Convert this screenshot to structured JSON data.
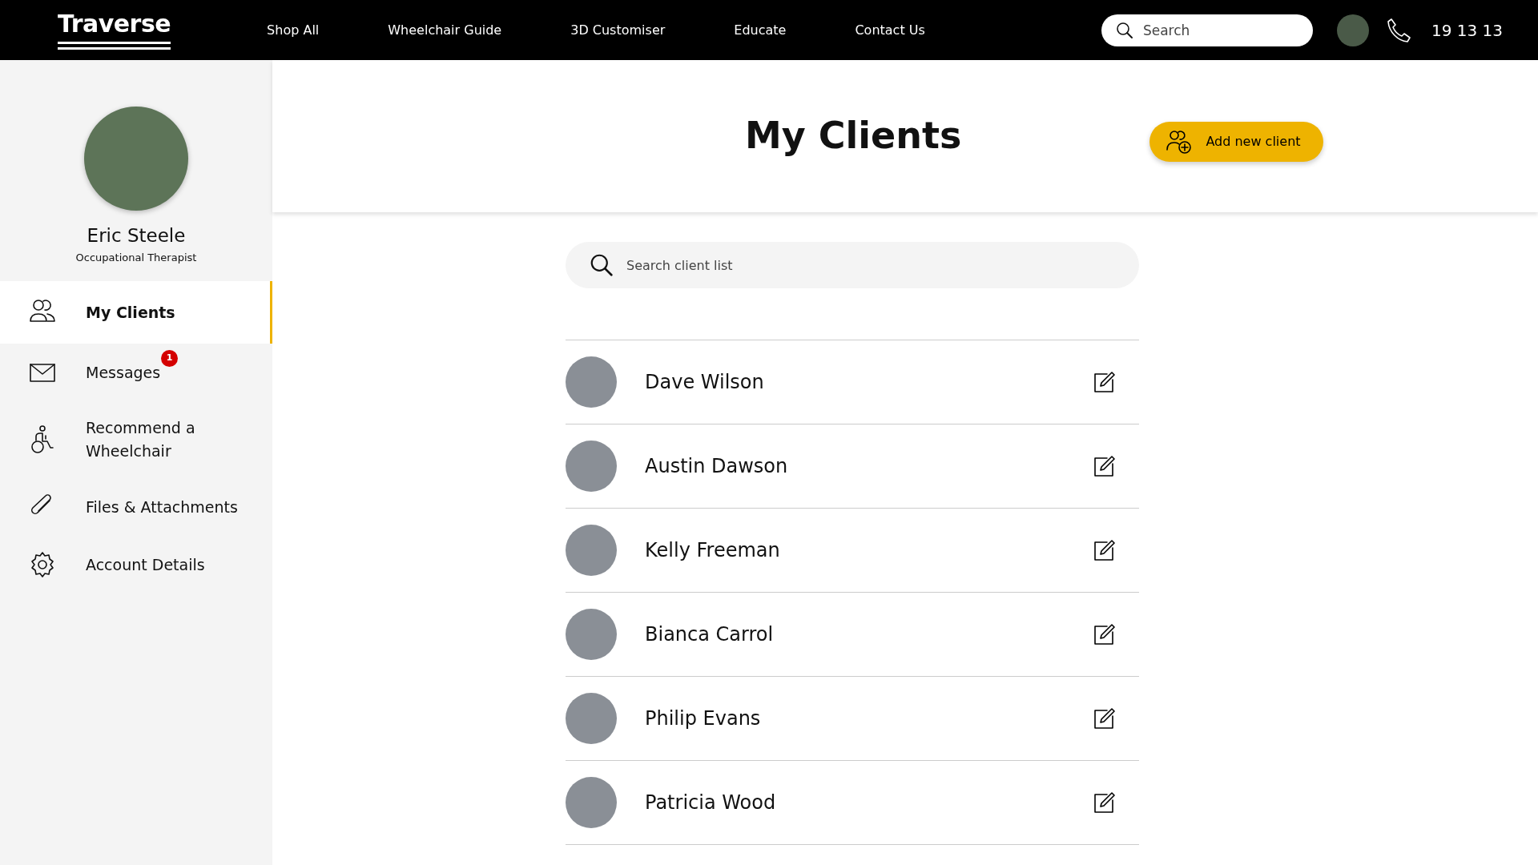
{
  "navbar": {
    "logo": "Traverse",
    "links": [
      {
        "label": "Shop All"
      },
      {
        "label": "Wheelchair Guide"
      },
      {
        "label": "3D Customiser"
      },
      {
        "label": "Educate"
      },
      {
        "label": "Contact Us"
      }
    ],
    "search": {
      "placeholder": "Search"
    },
    "phone": "19 13 13"
  },
  "sidebar": {
    "profile": {
      "name": "Eric Steele",
      "role": "Occupational Therapist"
    },
    "items": [
      {
        "kind": "clients",
        "label": "My Clients",
        "selected": true
      },
      {
        "kind": "messages",
        "label": "Messages",
        "selected": false,
        "badge": "1"
      },
      {
        "kind": "wheelchair",
        "label": "Recommend a Wheelchair",
        "selected": false
      },
      {
        "kind": "files",
        "label": "Files & Attachments",
        "selected": false
      },
      {
        "kind": "account",
        "label": "Account Details",
        "selected": false
      }
    ]
  },
  "main": {
    "title": "My Clients",
    "add_button": "Add new client",
    "search": {
      "placeholder": "Search client list"
    },
    "clients": [
      {
        "name": "Dave Wilson"
      },
      {
        "name": "Austin Dawson"
      },
      {
        "name": "Kelly Freeman"
      },
      {
        "name": "Bianca Carrol"
      },
      {
        "name": "Philip Evans"
      },
      {
        "name": "Patricia Wood"
      }
    ]
  }
}
